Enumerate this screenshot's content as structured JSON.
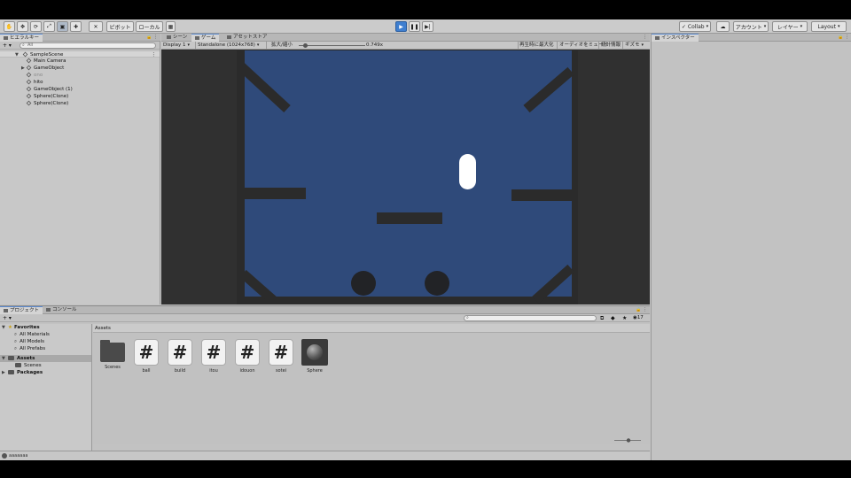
{
  "toolbar": {
    "pivot_label": "ピボット",
    "local_label": "ローカル",
    "collab_label": "Collab",
    "account_label": "アカウント",
    "layers_label": "レイヤー",
    "layout_label": "Layout",
    "colors": {
      "play_active": "#3f7fd0"
    }
  },
  "hierarchy": {
    "tab_label": "ヒエラルキー",
    "add_label": "+ ▾",
    "search_placeholder": "All",
    "scene_name": "SampleScene",
    "items": [
      {
        "label": "Main Camera",
        "dim": false,
        "has_children": false
      },
      {
        "label": "GameObject",
        "dim": false,
        "has_children": true
      },
      {
        "label": "ono",
        "dim": true,
        "has_children": false
      },
      {
        "label": "hito",
        "dim": false,
        "has_children": false
      },
      {
        "label": "GameObject (1)",
        "dim": false,
        "has_children": false
      },
      {
        "label": "Sphere(Clone)",
        "dim": false,
        "has_children": false
      },
      {
        "label": "Sphere(Clone)",
        "dim": false,
        "has_children": false
      }
    ]
  },
  "game_panel": {
    "tabs": [
      "シーン",
      "ゲーム",
      "アセットストア"
    ],
    "active_tab": "ゲーム",
    "display": "Display 1",
    "resolution": "Standalone (1024x768)",
    "scale_label": "拡大/縮小",
    "scale_value": "0.749x",
    "maximize_label": "再生時に最大化",
    "mute_label": "オーディオをミュート",
    "stats_label": "統計情報",
    "gizmos_label": "ギズモ",
    "scale_fraction": 0.1,
    "colors": {
      "background": "#2f4a7a",
      "obstacle": "#2b2b2b",
      "ball": "#222326",
      "player": "#ffffff"
    }
  },
  "inspector": {
    "tab_label": "インスペクター"
  },
  "project": {
    "tabs": [
      "プロジェクト",
      "コンソール"
    ],
    "active_tab": "プロジェクト",
    "add_label": "+ ▾",
    "search_placeholder": "",
    "count_label": "17",
    "favorites": {
      "label": "Favorites",
      "items": [
        "All Materials",
        "All Models",
        "All Prefabs"
      ]
    },
    "assets_root": {
      "label": "Assets",
      "children": [
        "Scenes"
      ]
    },
    "packages_label": "Packages",
    "breadcrumb": "Assets",
    "assets": [
      {
        "name": "Scenes",
        "kind": "folder"
      },
      {
        "name": "ball",
        "kind": "script"
      },
      {
        "name": "build",
        "kind": "script"
      },
      {
        "name": "itou",
        "kind": "script"
      },
      {
        "name": "idouon",
        "kind": "script"
      },
      {
        "name": "sotei",
        "kind": "script"
      },
      {
        "name": "Sphere",
        "kind": "material"
      }
    ]
  },
  "status": {
    "text": "aaaaaaa"
  }
}
